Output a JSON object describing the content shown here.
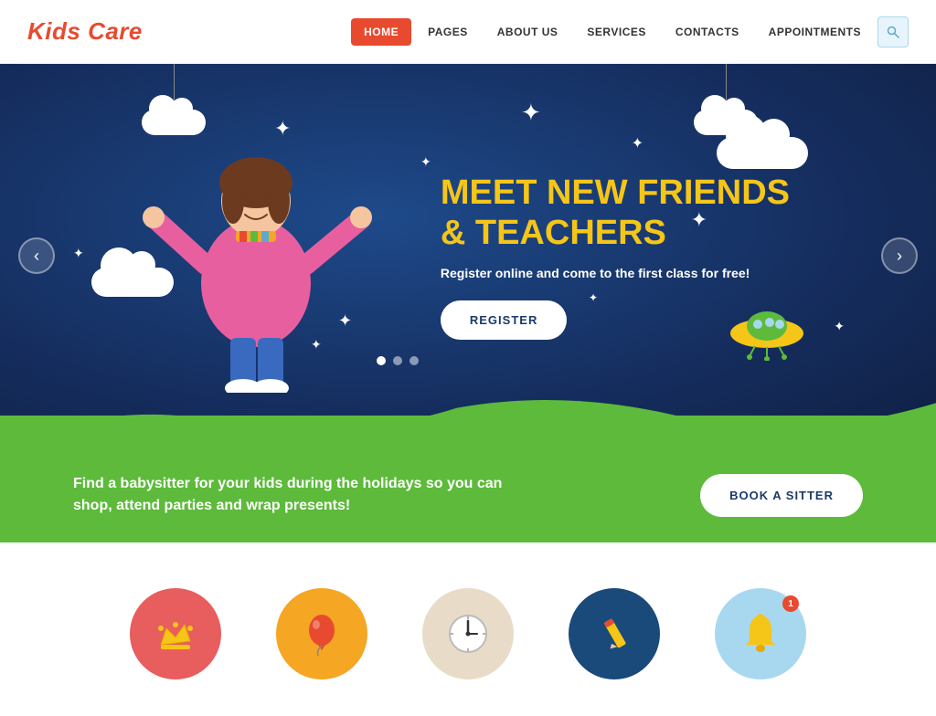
{
  "header": {
    "logo": "Kids Care",
    "nav": [
      {
        "label": "HOME",
        "active": true
      },
      {
        "label": "PAGES",
        "active": false
      },
      {
        "label": "ABOUT US",
        "active": false
      },
      {
        "label": "SERVICES",
        "active": false
      },
      {
        "label": "CONTACTS",
        "active": false
      },
      {
        "label": "APPOINTMENTS",
        "active": false
      }
    ]
  },
  "hero": {
    "title_line1": "MEET NEW FRIENDS",
    "title_line2": "& TEACHERS",
    "subtitle": "Register online and come to the first class for free!",
    "register_btn": "REGISTER",
    "dots": [
      true,
      false,
      false
    ]
  },
  "green_section": {
    "text": "Find a babysitter for your kids during the holidays so you can shop,\nattend parties and wrap presents!",
    "book_btn": "BOOK A SITTER"
  },
  "icons": [
    {
      "color": "ic-red",
      "symbol": "♛",
      "label": "crown"
    },
    {
      "color": "ic-yellow",
      "symbol": "🎈",
      "label": "balloon"
    },
    {
      "color": "ic-beige",
      "symbol": "🕐",
      "label": "clock"
    },
    {
      "color": "ic-blue",
      "symbol": "✏️",
      "label": "pencil"
    },
    {
      "color": "ic-lightblue",
      "symbol": "🔔",
      "label": "bell"
    }
  ]
}
